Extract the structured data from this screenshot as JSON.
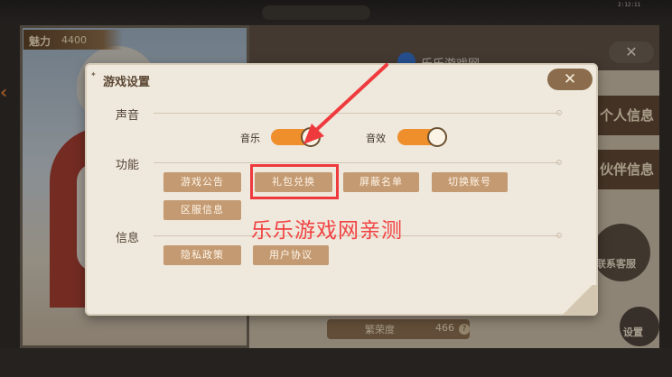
{
  "status": {
    "clock": "2:12:11"
  },
  "background": {
    "charm_label": "魅力",
    "charm_value": "4400",
    "panel_title": "乐乐游戏网",
    "side_tabs": [
      "个人信息",
      "伙伴信息"
    ],
    "service_label": "联系客服",
    "settings_label": "设置",
    "prosperity_label": "繁荣度",
    "prosperity_value": "466",
    "help_symbol": "?"
  },
  "dialog": {
    "title": "游戏设置",
    "title_deco": "✦",
    "close_symbol": "✕",
    "sections": {
      "sound": "声音",
      "function": "功能",
      "info": "信息"
    },
    "toggles": [
      {
        "label": "音乐",
        "on": true
      },
      {
        "label": "音效",
        "on": true
      }
    ],
    "function_buttons": [
      "游戏公告",
      "礼包兑换",
      "屏蔽名单",
      "切换账号",
      "区服信息"
    ],
    "info_buttons": [
      "隐私政策",
      "用户协议"
    ]
  },
  "annotation": {
    "watermark": "乐乐游戏网亲测",
    "accent_color": "#ef3a3d"
  },
  "colors": {
    "toggle_on": "#ee8f2c",
    "button": "#c49a72",
    "dialog_bg": "#efe8dc"
  }
}
